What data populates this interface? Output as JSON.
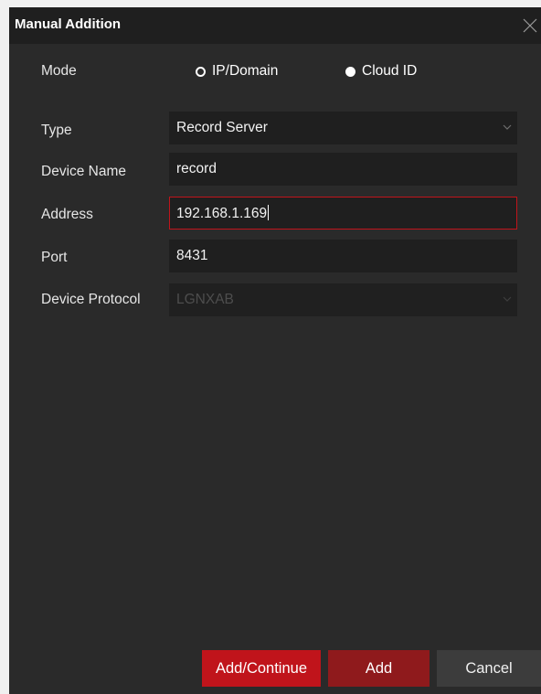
{
  "dialog": {
    "title": "Manual Addition",
    "close_icon": "close-icon"
  },
  "mode": {
    "label": "Mode",
    "options": [
      {
        "label": "IP/Domain",
        "selected": true
      },
      {
        "label": "Cloud ID",
        "selected": false
      }
    ]
  },
  "form": {
    "type": {
      "label": "Type",
      "value": "Record Server",
      "icon": "chevron-down-icon"
    },
    "device_name": {
      "label": "Device Name",
      "value": "record"
    },
    "address": {
      "label": "Address",
      "value": "192.168.1.169"
    },
    "port": {
      "label": "Port",
      "value": "8431"
    },
    "device_protocol": {
      "label": "Device Protocol",
      "value": "LGNXAB",
      "disabled": true,
      "icon": "chevron-down-icon"
    }
  },
  "buttons": {
    "add_continue": "Add/Continue",
    "add": "Add",
    "cancel": "Cancel"
  },
  "colors": {
    "background": "#2a2a2a",
    "titlebar": "#1f1f1f",
    "accent_red": "#c0141b",
    "add_button": "#8f1a1c",
    "cancel_button": "#3c3c3c"
  }
}
